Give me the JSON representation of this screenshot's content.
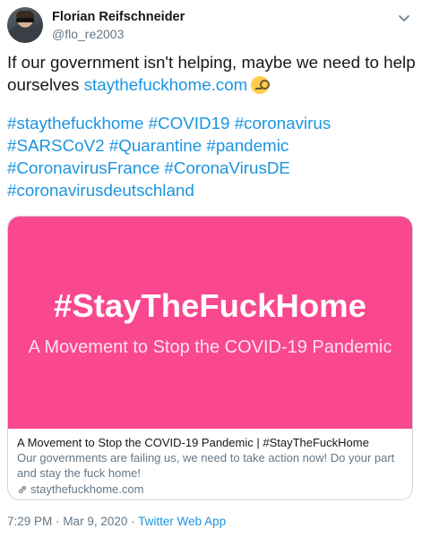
{
  "author": {
    "name": "Florian Reifschneider",
    "handle": "@flo_re2003"
  },
  "tweet": {
    "text_line1": "If our government isn't helping, maybe we need to help",
    "text_line2": "ourselves",
    "link": "staythefuckhome.com",
    "emoji": "face-with-monocle-icon",
    "hashtag_lines": [
      [
        "#staythefuckhome",
        "#COVID19",
        "#coronavirus"
      ],
      [
        "#SARSCoV2",
        "#Quarantine",
        "#pandemic"
      ],
      [
        "#CoronavirusFrance",
        "#CoronaVirusDE"
      ],
      [
        "#coronavirusdeutschland"
      ]
    ]
  },
  "card": {
    "image_title": "#StayTheFuckHome",
    "image_subtitle": "A Movement to Stop the COVID-19 Pandemic",
    "title": "A Movement to Stop the COVID-19 Pandemic | #StayTheFuckHome",
    "description_line1": "Our governments are failing us, we need to take action now! Do your part",
    "description_line2": "and stay the fuck home!",
    "domain": "staythefuckhome.com",
    "image_color": "#f9488f"
  },
  "footer": {
    "time": "7:29 PM",
    "separator1": "·",
    "date": "Mar 9, 2020",
    "separator2": "·",
    "app": "Twitter Web App"
  },
  "colors": {
    "link": "#1b95e0",
    "muted": "#657786",
    "text": "#14171a"
  }
}
